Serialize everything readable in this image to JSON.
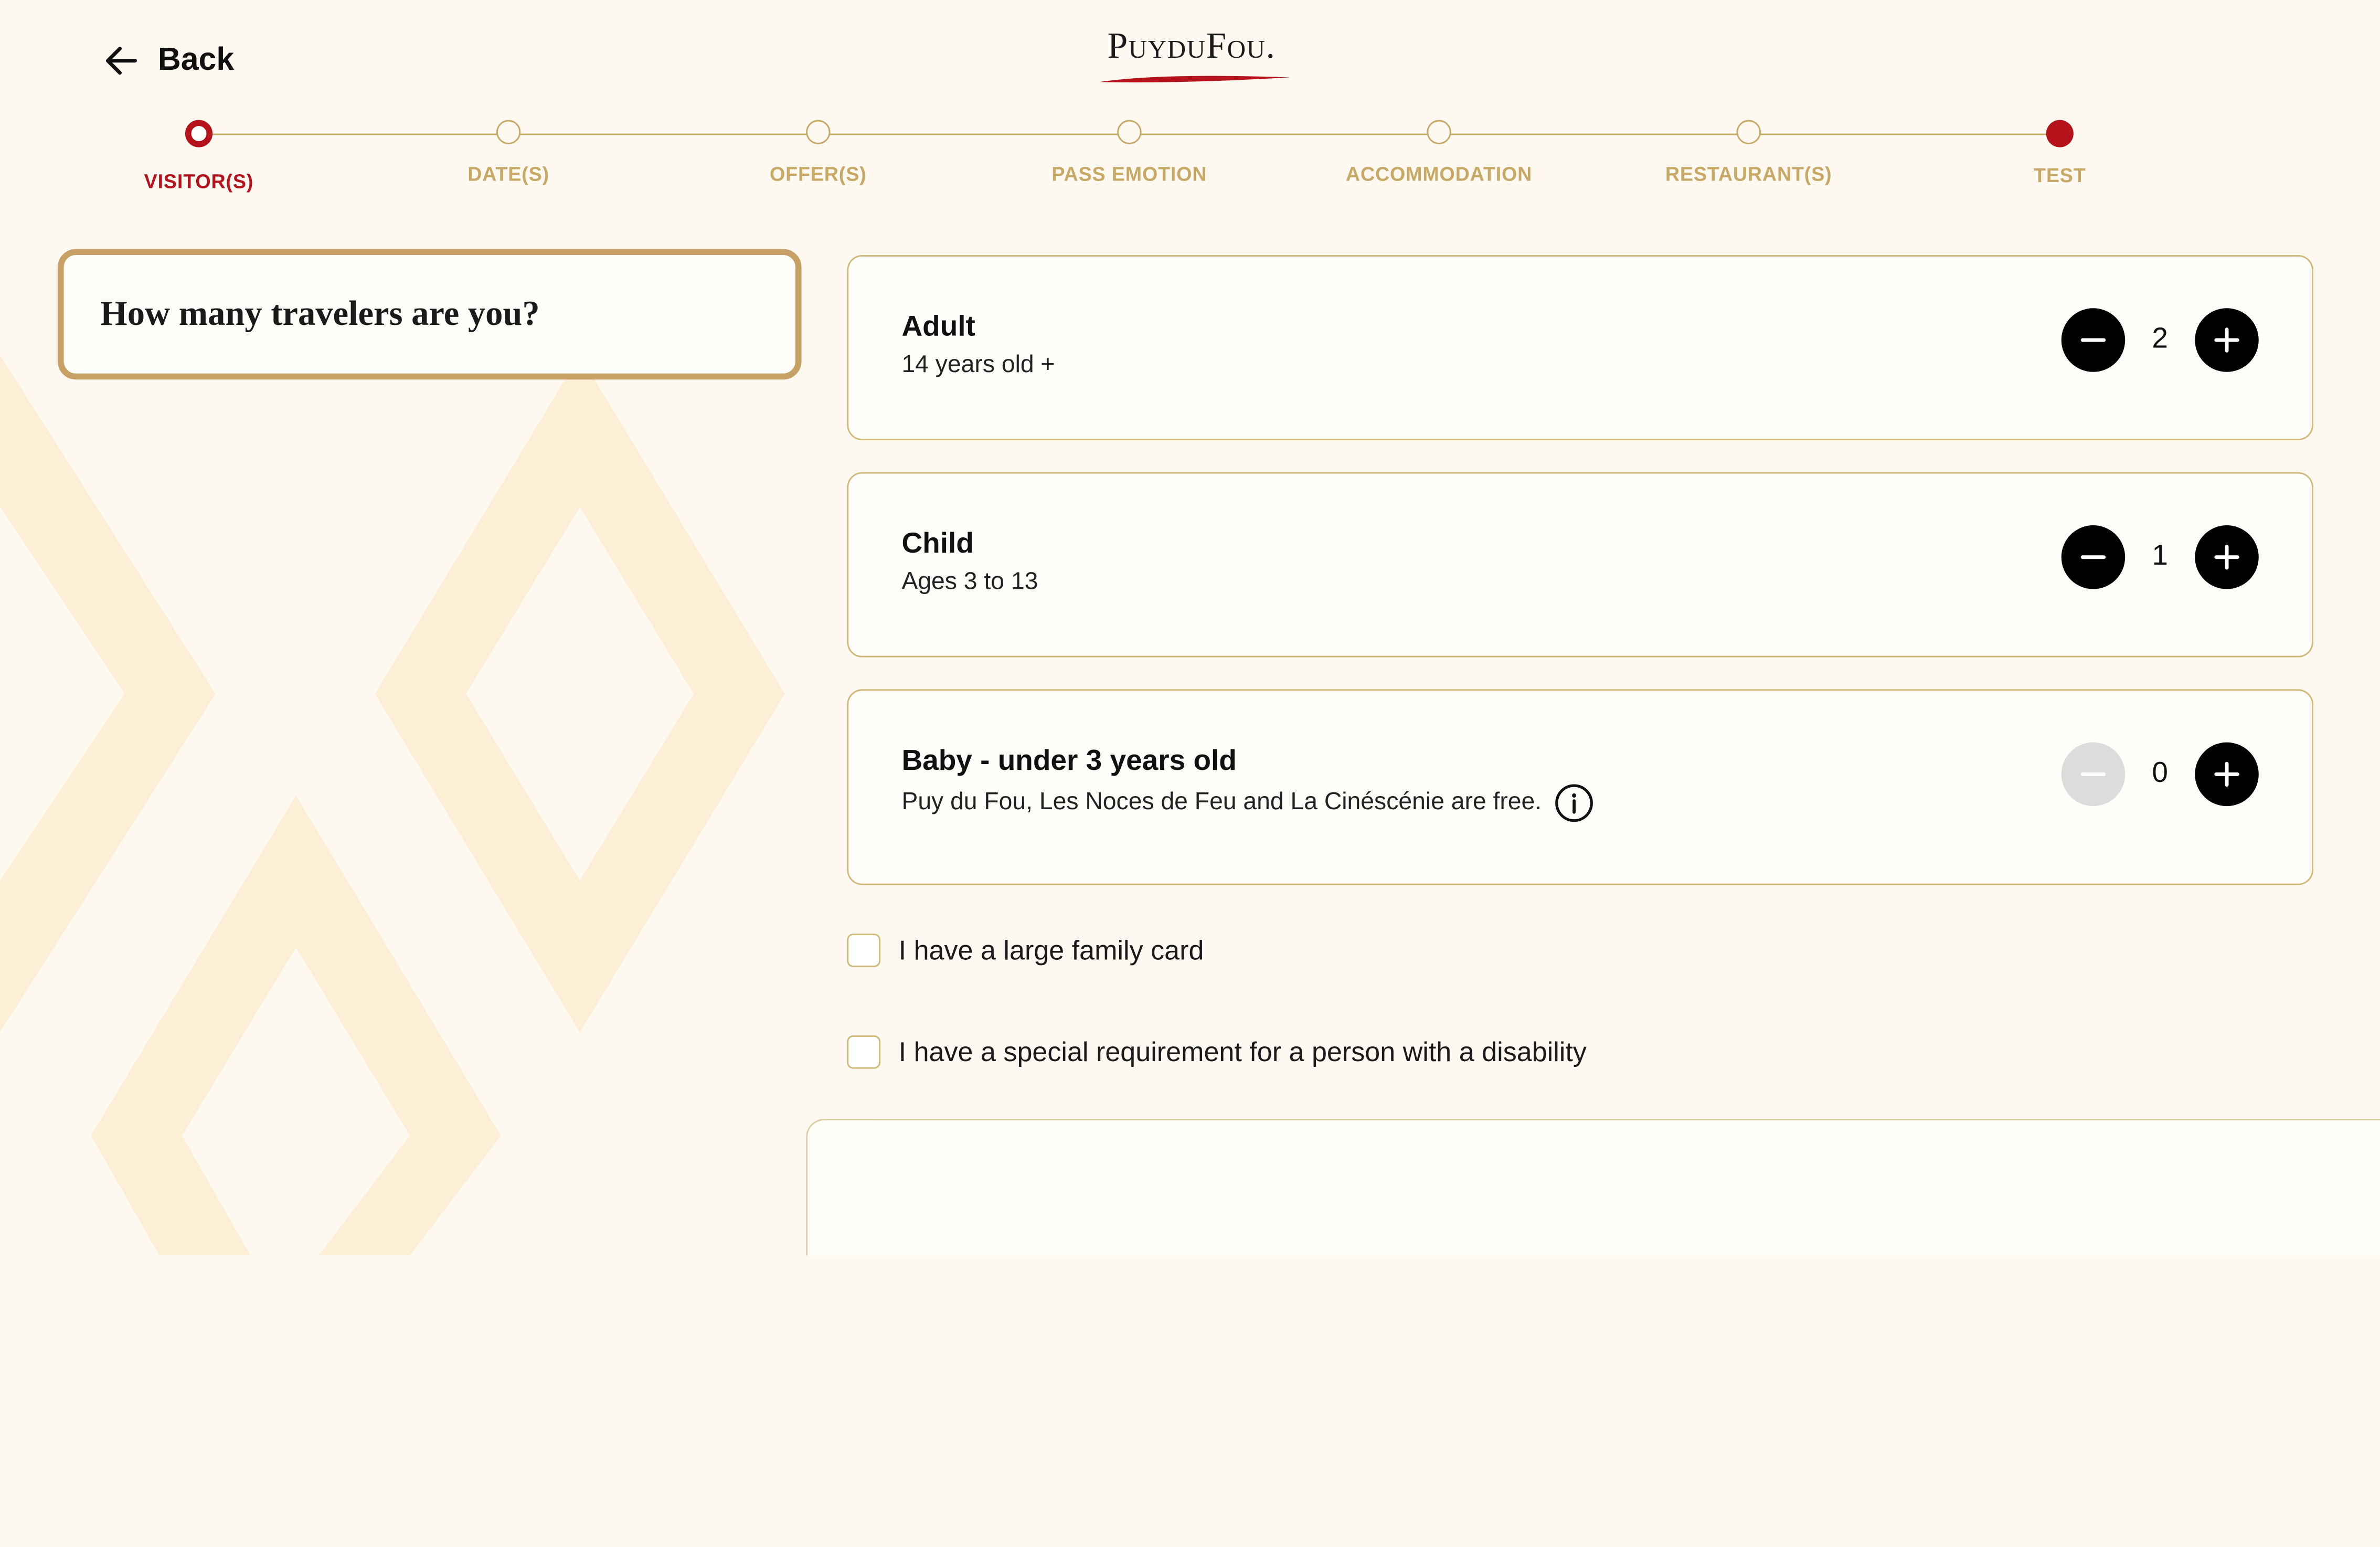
{
  "header": {
    "back_label": "Back",
    "logo_text": "PuyduFou."
  },
  "stepper": {
    "steps": [
      {
        "label": "VISITOR(S)",
        "state": "active"
      },
      {
        "label": "DATE(S)",
        "state": "pending"
      },
      {
        "label": "OFFER(S)",
        "state": "pending"
      },
      {
        "label": "PASS EMOTION",
        "state": "pending"
      },
      {
        "label": "ACCOMMODATION",
        "state": "pending"
      },
      {
        "label": "RESTAURANT(S)",
        "state": "pending"
      },
      {
        "label": "TEST",
        "state": "filled"
      }
    ]
  },
  "question": {
    "text": "How many travelers are you?"
  },
  "travelers": [
    {
      "title": "Adult",
      "subtitle": "14 years old +",
      "count": "2",
      "minus_enabled": true
    },
    {
      "title": "Child",
      "subtitle": "Ages 3 to 13",
      "count": "1",
      "minus_enabled": true
    },
    {
      "title": "Baby - under 3 years old",
      "subtitle": "Puy du Fou, Les Noces de Feu and La Cinéscénie are free.",
      "count": "0",
      "minus_enabled": false
    }
  ],
  "options": {
    "large_family_label": "I have a large family card",
    "disability_label": "I have a special requirement for a person with a disability"
  },
  "colors": {
    "accent_red": "#b5121b",
    "gold": "#c7a965",
    "background": "#fdf8f0",
    "pattern": "#fdeed6"
  },
  "icons": {
    "back": "arrow-left-icon",
    "minus": "minus-icon",
    "plus": "plus-icon",
    "info": "info-icon"
  }
}
